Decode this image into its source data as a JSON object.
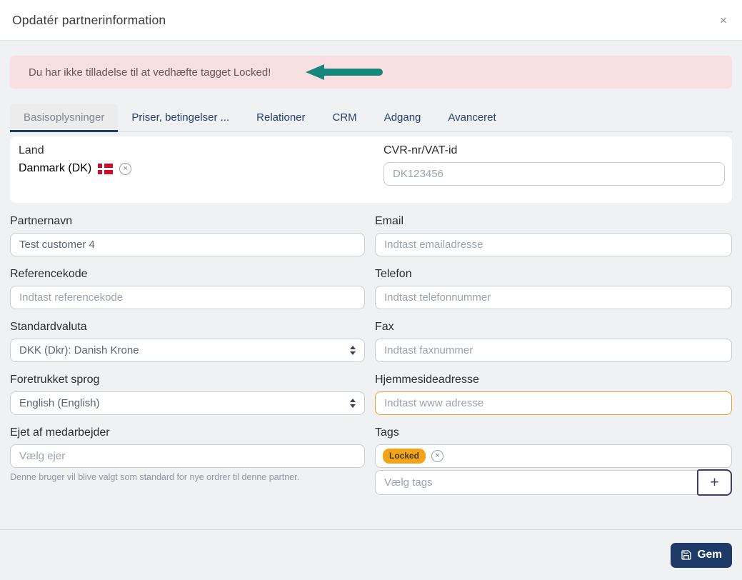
{
  "modal": {
    "title": "Opdatér partnerinformation"
  },
  "icons": {
    "close": "×",
    "clear": "×",
    "add": "+"
  },
  "alert": {
    "text": "Du har ikke tilladelse til at vedhæfte tagget Locked!"
  },
  "tabs": [
    {
      "label": "Basisoplysninger",
      "active": true
    },
    {
      "label": "Priser, betingelser ...",
      "active": false
    },
    {
      "label": "Relationer",
      "active": false
    },
    {
      "label": "CRM",
      "active": false
    },
    {
      "label": "Adgang",
      "active": false
    },
    {
      "label": "Avanceret",
      "active": false
    }
  ],
  "form": {
    "land": {
      "label": "Land",
      "value": "Danmark (DK)"
    },
    "cvr": {
      "label": "CVR-nr/VAT-id",
      "placeholder": "DK123456"
    },
    "partnernavn": {
      "label": "Partnernavn",
      "value": "Test customer 4"
    },
    "email": {
      "label": "Email",
      "placeholder": "Indtast emailadresse"
    },
    "referencekode": {
      "label": "Referencekode",
      "placeholder": "Indtast referencekode"
    },
    "telefon": {
      "label": "Telefon",
      "placeholder": "Indtast telefonnummer"
    },
    "standardvaluta": {
      "label": "Standardvaluta",
      "value": "DKK (Dkr): Danish Krone"
    },
    "fax": {
      "label": "Fax",
      "placeholder": "Indtast faxnummer"
    },
    "sprog": {
      "label": "Foretrukket sprog",
      "value": "English (English)"
    },
    "hjemmeside": {
      "label": "Hjemmesideadresse",
      "placeholder": "Indtast www adresse"
    },
    "ejer": {
      "label": "Ejet af medarbejder",
      "placeholder": "Vælg ejer",
      "helper": "Denne bruger vil blive valgt som standard for nye ordrer til denne partner."
    },
    "tags": {
      "label": "Tags",
      "tag": "Locked",
      "placeholder": "Vælg tags"
    }
  },
  "footer": {
    "save_label": "Gem"
  },
  "colors": {
    "accent_navy": "#1d3b6d",
    "save_button_bg": "#1e3a66",
    "alert_bg": "#f7dfe2",
    "alert_text": "#6d5258",
    "arrow_teal": "#17867b",
    "tag_orange": "#f2a41c",
    "highlight_border": "#efa02f",
    "flag_red": "#c8102e",
    "body_bg": "#f0f1f3"
  }
}
